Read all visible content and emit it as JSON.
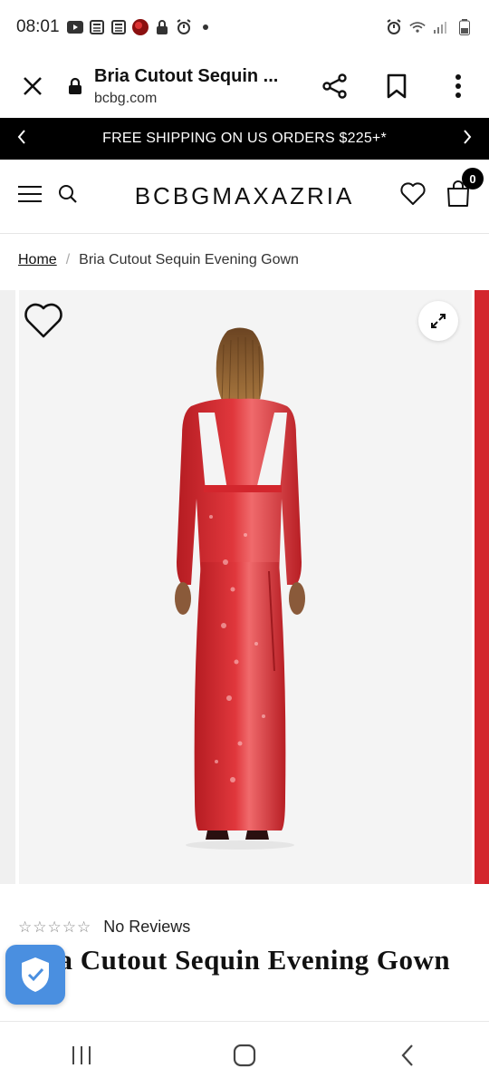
{
  "status_bar": {
    "time": "08:01",
    "left_icons": [
      "youtube-icon",
      "news-icon",
      "news-icon",
      "app-icon",
      "lock-icon",
      "alarm-icon",
      "dot-icon"
    ],
    "right_icons": [
      "alarm-icon",
      "wifi-icon",
      "signal-icon",
      "battery-icon"
    ]
  },
  "browser": {
    "title": "Bria Cutout Sequin ...",
    "domain": "bcbg.com",
    "icons": [
      "close-icon",
      "lock-icon",
      "share-icon",
      "bookmark-icon",
      "more-icon"
    ]
  },
  "promo": {
    "text": "FREE SHIPPING ON US ORDERS $225+*"
  },
  "header": {
    "brand": "BCBGMAXAZRIA",
    "cart_count": "0"
  },
  "breadcrumb": {
    "home": "Home",
    "separator": "/",
    "current": "Bria Cutout Sequin Evening Gown"
  },
  "product": {
    "reviews_label": "No Reviews",
    "rating": 0,
    "rating_max": 5,
    "title": "Bria Cutout Sequin Evening Gown",
    "dress_color": "#d3262d"
  }
}
